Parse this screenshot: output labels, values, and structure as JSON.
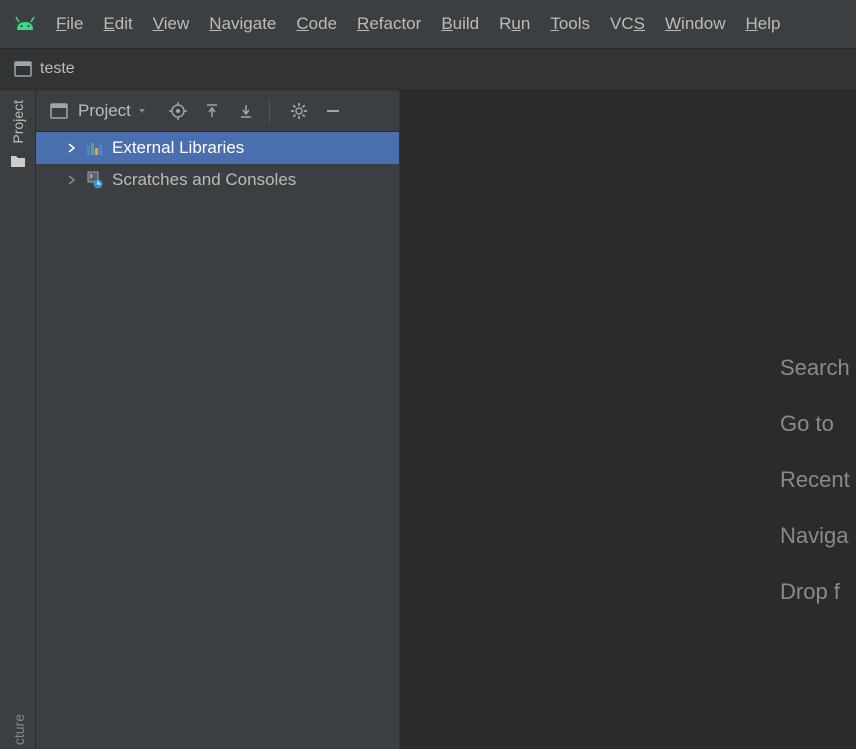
{
  "menu": {
    "items": [
      "File",
      "Edit",
      "View",
      "Navigate",
      "Code",
      "Refactor",
      "Build",
      "Run",
      "Tools",
      "VCS",
      "Window",
      "Help"
    ],
    "mnemonicIndex": [
      0,
      0,
      0,
      0,
      0,
      0,
      0,
      1,
      0,
      2,
      0,
      0
    ]
  },
  "breadcrumb": {
    "project": "teste"
  },
  "leftGutter": {
    "tabLabel": "Project",
    "bottomLabel": "cture"
  },
  "projectPanel": {
    "title": "Project",
    "tree": [
      {
        "label": "External Libraries",
        "iconType": "libraries",
        "selected": true,
        "chevron": "right"
      },
      {
        "label": "Scratches and Consoles",
        "iconType": "scratches",
        "selected": false,
        "chevron": "right"
      }
    ]
  },
  "editorHints": [
    "Search",
    "Go to ",
    "Recent",
    "Naviga",
    "Drop f"
  ],
  "colors": {
    "selection": "#4b6eaf",
    "editorBg": "#2b2b2b",
    "panelBg": "#3c3f41"
  }
}
